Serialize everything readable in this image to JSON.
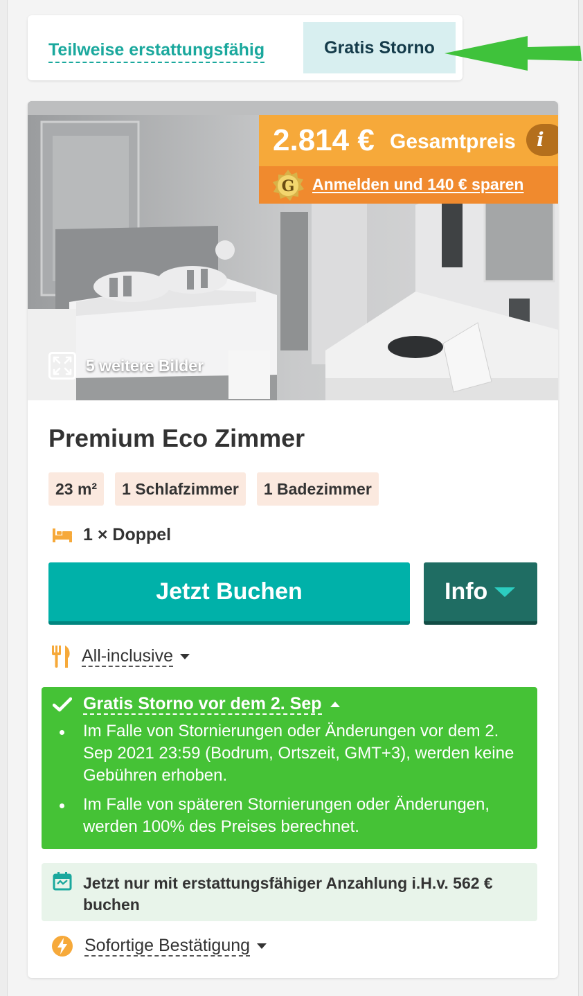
{
  "tabs": {
    "partial_label": "Teilweise erstattungsfähig",
    "free_cancel_label": "Gratis Storno"
  },
  "offer": {
    "price": "2.814 €",
    "price_label": "Gesamtpreis",
    "info_icon_char": "i",
    "login_badge": "G",
    "login_cta": "Anmelden und 140 € sparen",
    "more_images": "5 weitere Bilder"
  },
  "room": {
    "title": "Premium Eco Zimmer",
    "chips": [
      "23 m²",
      "1 Schlafzimmer",
      "1 Badezimmer"
    ],
    "bed": "1 × Doppel"
  },
  "actions": {
    "book_label": "Jetzt Buchen",
    "info_label": "Info"
  },
  "meal": {
    "label": "All-inclusive"
  },
  "cancellation": {
    "heading": "Gratis Storno vor dem 2. Sep",
    "items": [
      "Im Falle von Stornierungen oder Änderungen vor dem 2. Sep 2021 23:59 (Bodrum, Ortszeit, GMT+3), werden keine Gebühren erhoben.",
      "Im Falle von späteren Stornierungen oder Änderungen, werden 100% des Preises berechnet."
    ]
  },
  "deposit": {
    "text": "Jetzt nur mit erstattungsfähiger Anzahlung i.H.v. 562 € buchen"
  },
  "confirmation": {
    "label": "Sofortige Bestätigung"
  },
  "colors": {
    "teal": "#00b1a9",
    "dark_teal": "#1f6d63",
    "orange": "#f6a93a",
    "dark_orange": "#f08a2e",
    "green": "#45c236",
    "arrow_green": "#3fc23b"
  },
  "icons": [
    "green-arrow",
    "info-icon",
    "gold-g-badge-icon",
    "expand-icon",
    "bed-icon",
    "caret-down-icon",
    "cutlery-icon",
    "checkmark-icon",
    "caret-up-icon",
    "calendar-icon",
    "lightning-icon"
  ]
}
